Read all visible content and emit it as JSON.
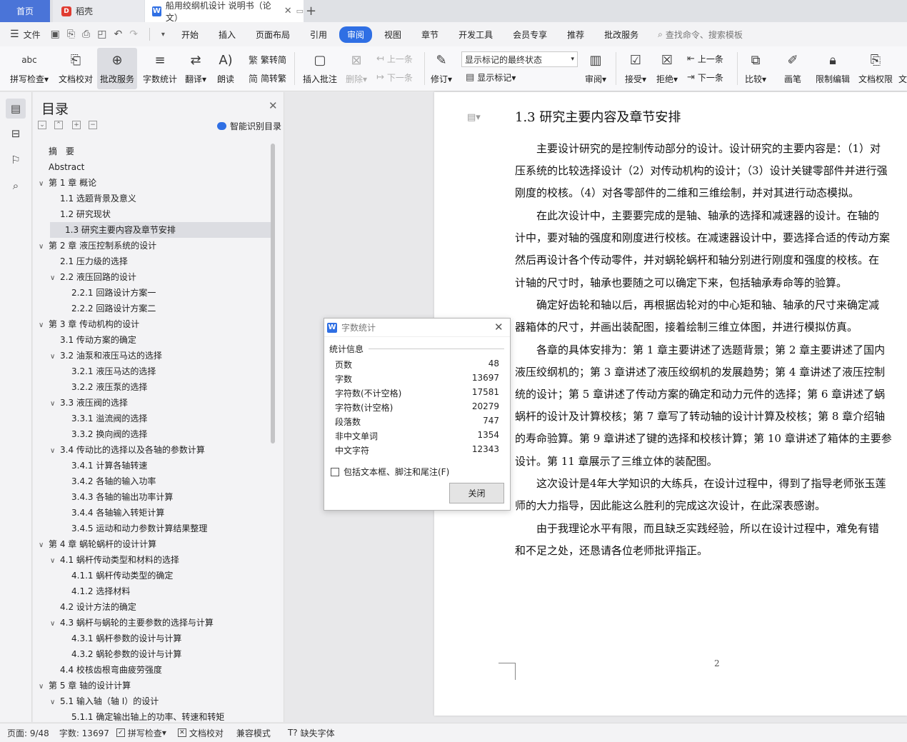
{
  "titlebar": {
    "home": "首页",
    "daoke": "稻壳",
    "doc_title": "船用绞纲机设计 说明书（论文）"
  },
  "menubar": {
    "file": "文件",
    "tabs": [
      "开始",
      "插入",
      "页面布局",
      "引用",
      "审阅",
      "视图",
      "章节",
      "开发工具",
      "会员专享",
      "推荐",
      "批改服务"
    ],
    "active_tab": "审阅",
    "search": "查找命令、搜索模板"
  },
  "ribbon": {
    "spell": "拼写检查",
    "proof": "文档校对",
    "grading": "批改服务",
    "wordcount": "字数统计",
    "translate": "翻译",
    "read": "朗读",
    "trad": "繁转简",
    "simp": "简转繁",
    "insert_comment": "插入批注",
    "delete": "删除",
    "prev": "上一条",
    "next": "下一条",
    "track": "修订",
    "display_state": "显示标记的最终状态",
    "show_marks": "显示标记",
    "review": "审阅",
    "accept": "接受",
    "reject": "拒绝",
    "prev2": "上一条",
    "next2": "下一条",
    "compare": "比较",
    "pen": "画笔",
    "restrict": "限制编辑",
    "permission": "文档权限",
    "cut_label": "文"
  },
  "toc": {
    "title": "目录",
    "smart": "智能识别目录",
    "items": [
      {
        "text": "摘　要",
        "level": 0,
        "arrow": ""
      },
      {
        "text": "Abstract",
        "level": 0,
        "arrow": ""
      },
      {
        "text": "第 1 章  概论",
        "level": 0,
        "arrow": "v"
      },
      {
        "text": "1.1 选题背景及意义",
        "level": 1,
        "arrow": ""
      },
      {
        "text": "1.2 研究现状",
        "level": 1,
        "arrow": ""
      },
      {
        "text": "1.3 研究主要内容及章节安排",
        "level": 1,
        "arrow": "",
        "selected": true
      },
      {
        "text": "第 2 章  液压控制系统的设计",
        "level": 0,
        "arrow": "v"
      },
      {
        "text": "2.1 压力级的选择",
        "level": 1,
        "arrow": ""
      },
      {
        "text": "2.2  液压回路的设计",
        "level": 1,
        "arrow": "v"
      },
      {
        "text": "2.2.1  回路设计方案一",
        "level": 2,
        "arrow": ""
      },
      {
        "text": "2.2.2  回路设计方案二",
        "level": 2,
        "arrow": ""
      },
      {
        "text": "第 3 章  传动机构的设计",
        "level": 0,
        "arrow": "v"
      },
      {
        "text": "3.1 传动方案的确定",
        "level": 1,
        "arrow": ""
      },
      {
        "text": "3.2 油泵和液压马达的选择",
        "level": 1,
        "arrow": "v"
      },
      {
        "text": "3.2.1  液压马达的选择",
        "level": 2,
        "arrow": ""
      },
      {
        "text": "3.2.2  液压泵的选择",
        "level": 2,
        "arrow": ""
      },
      {
        "text": "3.3  液压阀的选择",
        "level": 1,
        "arrow": "v"
      },
      {
        "text": "3.3.1  溢流阀的选择",
        "level": 2,
        "arrow": ""
      },
      {
        "text": "3.3.2  换向阀的选择",
        "level": 2,
        "arrow": ""
      },
      {
        "text": "3.4    传动比的选择以及各轴的参数计算",
        "level": 1,
        "arrow": "v"
      },
      {
        "text": "3.4.1    计算各轴转速",
        "level": 2,
        "arrow": ""
      },
      {
        "text": "3.4.2    各轴的输入功率",
        "level": 2,
        "arrow": ""
      },
      {
        "text": "3.4.3    各轴的输出功率计算",
        "level": 2,
        "arrow": ""
      },
      {
        "text": "3.4.4    各轴输入转矩计算",
        "level": 2,
        "arrow": ""
      },
      {
        "text": "3.4.5 运动和动力参数计算结果整理",
        "level": 2,
        "arrow": ""
      },
      {
        "text": "第 4 章    蜗轮蜗杆的设计计算",
        "level": 0,
        "arrow": "v"
      },
      {
        "text": "4.1    蜗杆传动类型和材料的选择",
        "level": 1,
        "arrow": "v"
      },
      {
        "text": "4.1.1    蜗杆传动类型的确定",
        "level": 2,
        "arrow": ""
      },
      {
        "text": "4.1.2    选择材料",
        "level": 2,
        "arrow": ""
      },
      {
        "text": "4.2  设计方法的确定",
        "level": 1,
        "arrow": ""
      },
      {
        "text": "4.3    蜗杆与蜗轮的主要参数的选择与计算",
        "level": 1,
        "arrow": "v"
      },
      {
        "text": "4.3.1    蜗杆参数的设计与计算",
        "level": 2,
        "arrow": ""
      },
      {
        "text": "4.3.2    蜗轮参数的设计与计算",
        "level": 2,
        "arrow": ""
      },
      {
        "text": "4.4    校核齿根弯曲疲劳强度",
        "level": 1,
        "arrow": ""
      },
      {
        "text": "第 5 章    轴的设计计算",
        "level": 0,
        "arrow": "v"
      },
      {
        "text": "5.1    输入轴（轴 I）的设计",
        "level": 1,
        "arrow": "v"
      },
      {
        "text": "5.1.1    确定输出轴上的功率、转速和转矩",
        "level": 2,
        "arrow": ""
      }
    ]
  },
  "document": {
    "heading": "1.3 研究主要内容及章节安排",
    "lines": [
      "　　主要设计研究的是控制传动部分的设计。设计研究的主要内容是：（1）对",
      "压系统的比较选择设计（2）对传动机构的设计；（3）设计关键零部件并进行强",
      "刚度的校核。（4）对各零部件的二维和三维绘制，并对其进行动态模拟。",
      "　　在此次设计中，主要要完成的是轴、轴承的选择和减速器的设计。在轴的",
      "计中，要对轴的强度和刚度进行校核。在减速器设计中，要选择合适的传动方案",
      "然后再设计各个传动零件，并对蜗轮蜗杆和轴分别进行刚度和强度的校核。在",
      "计轴的尺寸时，轴承也要随之可以确定下来，包括轴承寿命等的验算。",
      "　　确定好齿轮和轴以后，再根据齿轮对的中心矩和轴、轴承的尺寸来确定减",
      "器箱体的尺寸，并画出装配图，接着绘制三维立体图，并进行模拟仿真。",
      "　　各章的具体安排为：第 1 章主要讲述了选题背景；第 2 章主要讲述了国内",
      "液压绞纲机的；第 3 章讲述了液压绞纲机的发展趋势；第 4 章讲述了液压控制",
      "统的设计；第 5 章讲述了传动方案的确定和动力元件的选择；第 6 章讲述了蜗",
      "蜗杆的设计及计算校核；第 7 章写了转动轴的设计计算及校核；第 8 章介绍轴",
      "的寿命验算。第 9 章讲述了键的选择和校核计算；第 10 章讲述了箱体的主要参",
      "设计。第 11 章展示了三维立体的装配图。",
      "　　这次设计是4年大学知识的大练兵，在设计过程中，得到了指导老师张玉莲",
      "师的大力指导，因此能这么胜利的完成这次设计，在此深表感谢。",
      "　　由于我理论水平有限，而且缺乏实践经验，所以在设计过程中，难免有错",
      "和不足之处，还恳请各位老师批评指正。"
    ],
    "page_number": "2"
  },
  "dialog": {
    "title": "字数统计",
    "group": "统计信息",
    "stats": [
      {
        "label": "页数",
        "value": "48"
      },
      {
        "label": "字数",
        "value": "13697"
      },
      {
        "label": "字符数(不计空格)",
        "value": "17581"
      },
      {
        "label": "字符数(计空格)",
        "value": "20279"
      },
      {
        "label": "段落数",
        "value": "747"
      },
      {
        "label": "非中文单词",
        "value": "1354"
      },
      {
        "label": "中文字符",
        "value": "12343"
      }
    ],
    "checkbox": "包括文本框、脚注和尾注(F)",
    "close": "关闭"
  },
  "statusbar": {
    "page": "页面: 9/48",
    "words": "字数: 13697",
    "spell": "拼写检查",
    "proof": "文档校对",
    "compat": "兼容模式",
    "missing_font": "缺失字体"
  }
}
